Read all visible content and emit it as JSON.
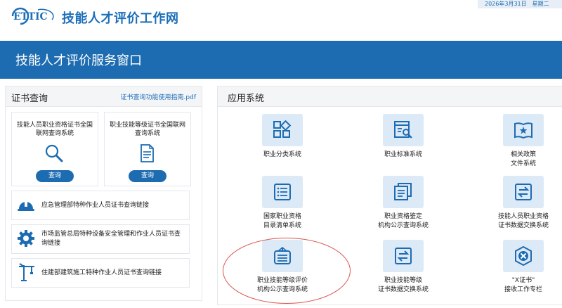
{
  "header": {
    "logo_text": "ETTIC",
    "site_title": "技能人才评价工作网",
    "date": "2026年3月31日",
    "weekday": "星期二"
  },
  "banner": {
    "title": "技能人才评价服务窗口"
  },
  "cert_query": {
    "title": "证书查询",
    "guide_link": "证书查询功能使用指南.pdf",
    "cards": [
      {
        "label": "技能人员职业资格证书全国联网查询系统",
        "icon": "search-icon",
        "button": "查询"
      },
      {
        "label": "职业技能等级证书全国联网查询系统",
        "icon": "document-icon",
        "button": "查询"
      }
    ],
    "links": [
      {
        "label": "应急管理部特种作业人员证书查询链接",
        "icon": "helmet-icon"
      },
      {
        "label": "市场监管总局特种设备安全管理和作业人员证书查询链接",
        "icon": "gear-icon"
      },
      {
        "label": "住建部建筑施工特种作业人员证书查询链接",
        "icon": "crane-icon"
      }
    ]
  },
  "apps": {
    "title": "应用系统",
    "items": [
      {
        "line1": "职业分类系统",
        "line2": "",
        "icon": "grid-icon"
      },
      {
        "line1": "职业标准系统",
        "line2": "",
        "icon": "standard-search-icon"
      },
      {
        "line1": "相关政策",
        "line2": "文件系统",
        "icon": "policy-book-icon"
      },
      {
        "line1": "国家职业资格",
        "line2": "目录清单系统",
        "icon": "list-icon"
      },
      {
        "line1": "职业资格鉴定",
        "line2": "机构公示查询系统",
        "icon": "documents-icon"
      },
      {
        "line1": "技能人员职业资格",
        "line2": "证书数据交换系统",
        "icon": "exchange-icon"
      },
      {
        "line1": "职业技能等级评价",
        "line2": "机构公示查询系统",
        "icon": "signboard-icon"
      },
      {
        "line1": "职业技能等级",
        "line2": "证书数据交换系统",
        "icon": "exchange-icon"
      },
      {
        "line1": "\"X证书\"",
        "line2": "接收工作专栏",
        "icon": "x-certificate-icon"
      }
    ]
  },
  "colors": {
    "primary": "#1d6cb1",
    "tile": "#dce9f7",
    "highlight_circle": "#d9534f"
  }
}
